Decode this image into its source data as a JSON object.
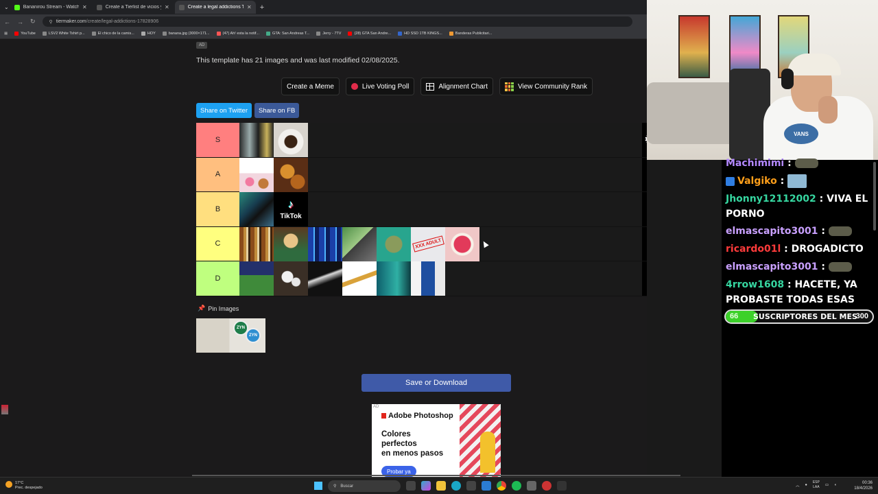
{
  "browser": {
    "tabs": [
      {
        "title": "Bananirou Stream - Watch Live",
        "active": false
      },
      {
        "title": "Create a Tierlist de vicios y adic",
        "active": false
      },
      {
        "title": "Create a legal addictions Tier Li",
        "active": true
      }
    ],
    "url_host": "tiermaker.com",
    "url_path": "/create/legal-addictions-17828906",
    "bookmarks": [
      "YouTube",
      "LSV2 White Tshirt p...",
      "El chico de la camis...",
      "HOY",
      "banana.jpg (3000×171...",
      "(47) Ah! esta la notif...",
      "GTA: San Andreas T...",
      "Jerry - 7TV",
      "(28) GTA San Andre...",
      "HD SSD 1TB KINGS...",
      "Banderas Publicitari..."
    ]
  },
  "page": {
    "ad_tag": "AD",
    "template_info": "This template has 21 images and was last modified 02/08/2025.",
    "buttons": {
      "create_meme": "Create a Meme",
      "live_poll": "Live Voting Poll",
      "alignment": "Alignment Chart",
      "community": "View Community Rank"
    },
    "share": {
      "twitter": "Share on Twitter",
      "fb": "Share on FB"
    },
    "tiers": [
      {
        "label": "S",
        "color": "#ff7f7f",
        "items": [
          "monster-energy",
          "coffee"
        ]
      },
      {
        "label": "A",
        "color": "#ffbf7f",
        "items": [
          "sugar",
          "fast-food"
        ]
      },
      {
        "label": "B",
        "color": "#ffdf7f",
        "items": [
          "smartphone",
          "tiktok"
        ]
      },
      {
        "label": "C",
        "color": "#ffff7f",
        "items": [
          "alcohol",
          "gambling-table",
          "slot-machines",
          "online-betting",
          "cannabis",
          "xxx-adult",
          "tongue"
        ]
      },
      {
        "label": "D",
        "color": "#bfff7f",
        "items": [
          "sports-betting",
          "pills",
          "powder",
          "cigarette",
          "vape",
          "heated-tobacco"
        ]
      }
    ],
    "tiktok_label": "TikTok",
    "xxx_label": "XXX ADULT",
    "pin_images": "Pin Images",
    "zyn_label": "ZYN",
    "save_button": "Save or Download",
    "ad": {
      "tag": "AD",
      "title": "Adobe Photoshop",
      "text": "Colores\nperfectos\nen menos pasos",
      "cta": "Probar ya"
    }
  },
  "webcam": {
    "shirt_logo": "VANS"
  },
  "chat": [
    {
      "user": "Machimimi",
      "color": "#b388ff",
      "text": "",
      "emote": true
    },
    {
      "user": "Valgiko",
      "color": "#ff9f1a",
      "text": "",
      "badge": true,
      "avatar": true
    },
    {
      "user": "Jhonny12112002",
      "color": "#36d6a0",
      "text": "VIVA EL PORNO"
    },
    {
      "user": "elmascapito3001",
      "color": "#c9a0ff",
      "text": "",
      "emote": true
    },
    {
      "user": "ricardo01l",
      "color": "#ff3b3b",
      "text": "DROGADICTO"
    },
    {
      "user": "elmascapito3001",
      "color": "#c9a0ff",
      "text": "",
      "emote": true
    },
    {
      "user": "4rrow1608",
      "color": "#36d6a0",
      "text": "HACETE, YA PROBASTE TODAS ESAS"
    }
  ],
  "subs_goal": {
    "current": "66",
    "label": "SUSCRIPTORES DEL MES",
    "goal": "300",
    "progress": 0.22
  },
  "taskbar": {
    "temp": "17°C",
    "weather": "Prec. despejado",
    "search": "Buscar",
    "lang1": "ESP",
    "lang2": "LAA",
    "time": "00:36",
    "date": "18/4/2026"
  }
}
